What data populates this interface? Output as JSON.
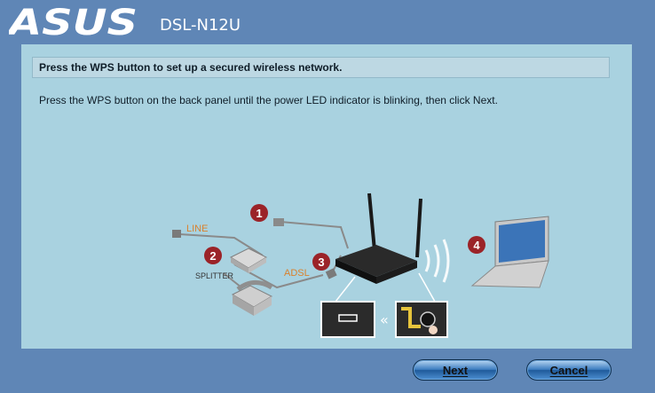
{
  "header": {
    "brand": "ASUS",
    "model": "DSL-N12U"
  },
  "main": {
    "title": "Press the WPS button to set up a secured wireless network.",
    "description": "Press the WPS button on the back panel until the power LED indicator is blinking, then click Next."
  },
  "diagram": {
    "line_label": "LINE",
    "splitter_label": "SPLITTER",
    "adsl_label": "ADSL",
    "steps": [
      "1",
      "2",
      "3",
      "4"
    ]
  },
  "buttons": {
    "next": "Next",
    "cancel": "Cancel"
  },
  "colors": {
    "background": "#5f86b6",
    "panel": "#a9d2e0",
    "step_badge": "#9b2328",
    "line_label": "#d9812d"
  }
}
